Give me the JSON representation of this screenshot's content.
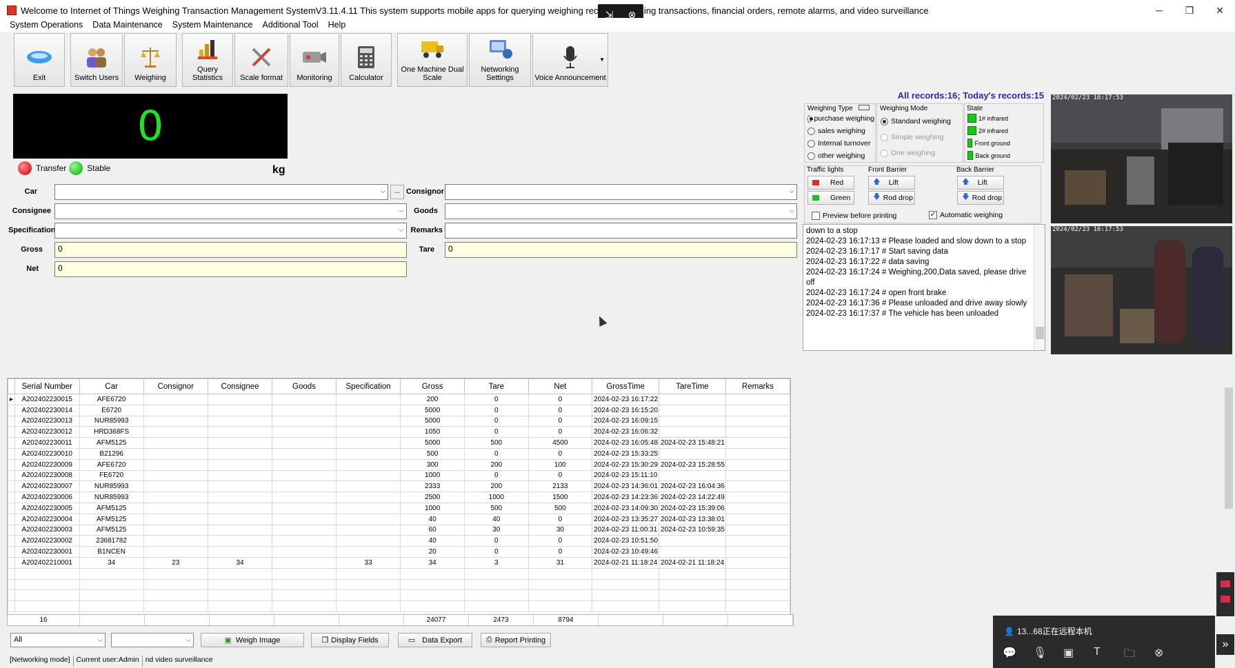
{
  "window": {
    "title": "Welcome to Internet of Things Weighing Transaction Management SystemV3.11.4.11 This system supports mobile apps for querying weighing records, weighing transactions, financial orders, remote alarms, and video surveillance",
    "minimize": "─",
    "maximize": "❐",
    "close": "✕"
  },
  "menu": [
    "System Operations",
    "Data Maintenance",
    "System Maintenance",
    "Additional Tool",
    "Help"
  ],
  "toolbar": [
    {
      "label": "Exit",
      "icon": "exit-icon"
    },
    {
      "label": "Switch Users",
      "icon": "users-icon"
    },
    {
      "label": "Weighing",
      "icon": "balance-scale-icon"
    },
    {
      "label": "Query Statistics",
      "icon": "chart-icon"
    },
    {
      "label": "Scale format",
      "icon": "tools-icon"
    },
    {
      "label": "Monitoring",
      "icon": "camera-icon"
    },
    {
      "label": "Calculator",
      "icon": "calculator-icon"
    },
    {
      "label": "One Machine Dual Scale",
      "icon": "truck-icon"
    },
    {
      "label": "Networking Settings",
      "icon": "network-icon"
    },
    {
      "label": "Voice Announcement",
      "icon": "microphone-icon"
    }
  ],
  "scale": {
    "weight": "0",
    "unit": "kg",
    "transfer_label": "Transfer",
    "stable_label": "Stable"
  },
  "form": {
    "car_label": "Car",
    "car_value": "",
    "consignor_label": "Consignor",
    "consignor_value": "",
    "consignee_label": "Consignee",
    "consignee_value": "",
    "goods_label": "Goods",
    "goods_value": "",
    "specification_label": "Specification",
    "specification_value": "",
    "remarks_label": "Remarks",
    "remarks_value": "",
    "gross_label": "Gross",
    "gross_value": "0",
    "tare_label": "Tare",
    "tare_value": "0",
    "net_label": "Net",
    "net_value": "0",
    "ellipsis": "..."
  },
  "records_summary": "All records:16; Today's records:15",
  "weighing_type": {
    "title": "Weighing Type",
    "options": [
      "purchase weighing",
      "sales weighing",
      "Internal turnover",
      "other weighing"
    ],
    "selected": 0
  },
  "weighing_mode": {
    "title": "Weighing Mode",
    "options": [
      "Standard weighing",
      "Simple weighing",
      "One weighing"
    ],
    "selected": 0
  },
  "state": {
    "title": "State",
    "items": [
      "1# infrared",
      "2# infrared",
      "Front ground",
      "Back ground"
    ],
    "color": "#18c818"
  },
  "traffic_lights": {
    "title": "Traffic lights",
    "red": "Red",
    "green": "Green"
  },
  "front_barrier": {
    "title": "Front Barrier",
    "lift": "Lift",
    "drop": "Rod drop"
  },
  "back_barrier": {
    "title": "Back Barrier",
    "lift": "Lift",
    "drop": "Rod drop"
  },
  "preview_before_printing": {
    "label": "Preview before printing",
    "checked": false
  },
  "automatic_weighing": {
    "label": "Automatic weighing",
    "checked": true
  },
  "log": [
    "down to a stop",
    "2024-02-23 16:17:13 # Please loaded and slow down to a stop",
    "2024-02-23 16:17:17 # Start saving data",
    "2024-02-23 16:17:22 # data saving",
    "2024-02-23 16:17:24 # Weighing,200,Data saved, please drive off",
    "2024-02-23 16:17:24 # open front brake",
    "2024-02-23 16:17:36 # Please unloaded and drive away slowly",
    "2024-02-23 16:17:37 # The vehicle has been unloaded"
  ],
  "cameras": [
    {
      "timestamp": "2024/02/23 16:17:53"
    },
    {
      "timestamp": "2024/02/23 16:17:53"
    }
  ],
  "table": {
    "columns": [
      "Serial Number",
      "Car",
      "Consignor",
      "Consignee",
      "Goods",
      "Specification",
      "Gross",
      "Tare",
      "Net",
      "GrossTime",
      "TareTime",
      "Remarks"
    ],
    "rows": [
      [
        "A202402230015",
        "AFE6720",
        "",
        "",
        "",
        "",
        "200",
        "0",
        "0",
        "2024-02-23 16:17:22",
        "",
        ""
      ],
      [
        "A202402230014",
        "E6720",
        "",
        "",
        "",
        "",
        "5000",
        "0",
        "0",
        "2024-02-23 16:15:20",
        "",
        ""
      ],
      [
        "A202402230013",
        "NUR85993",
        "",
        "",
        "",
        "",
        "5000",
        "0",
        "0",
        "2024-02-23 16:09:15",
        "",
        ""
      ],
      [
        "A202402230012",
        "HRD368FS",
        "",
        "",
        "",
        "",
        "1050",
        "0",
        "0",
        "2024-02-23 16:06:32",
        "",
        ""
      ],
      [
        "A202402230011",
        "AFM5125",
        "",
        "",
        "",
        "",
        "5000",
        "500",
        "4500",
        "2024-02-23 16:05:48",
        "2024-02-23 15:48:21",
        ""
      ],
      [
        "A202402230010",
        "B21296",
        "",
        "",
        "",
        "",
        "500",
        "0",
        "0",
        "2024-02-23 15:33:25",
        "",
        ""
      ],
      [
        "A202402230009",
        "AFE6720",
        "",
        "",
        "",
        "",
        "300",
        "200",
        "100",
        "2024-02-23 15:30:29",
        "2024-02-23 15:28:55",
        ""
      ],
      [
        "A202402230008",
        "FE6720",
        "",
        "",
        "",
        "",
        "1000",
        "0",
        "0",
        "2024-02-23 15:11:10",
        "",
        ""
      ],
      [
        "A202402230007",
        "NUR85993",
        "",
        "",
        "",
        "",
        "2333",
        "200",
        "2133",
        "2024-02-23 14:36:01",
        "2024-02-23 16:04:36",
        ""
      ],
      [
        "A202402230006",
        "NUR85993",
        "",
        "",
        "",
        "",
        "2500",
        "1000",
        "1500",
        "2024-02-23 14:23:36",
        "2024-02-23 14:22:49",
        ""
      ],
      [
        "A202402230005",
        "AFM5125",
        "",
        "",
        "",
        "",
        "1000",
        "500",
        "500",
        "2024-02-23 14:09:30",
        "2024-02-23 15:39:06",
        ""
      ],
      [
        "A202402230004",
        "AFM5125",
        "",
        "",
        "",
        "",
        "40",
        "40",
        "0",
        "2024-02-23 13:35:27",
        "2024-02-23 13:38:01",
        ""
      ],
      [
        "A202402230003",
        "AFM5125",
        "",
        "",
        "",
        "",
        "60",
        "30",
        "30",
        "2024-02-23 11:00:31",
        "2024-02-23 10:59:35",
        ""
      ],
      [
        "A202402230002",
        "23681782",
        "",
        "",
        "",
        "",
        "40",
        "0",
        "0",
        "2024-02-23 10:51:50",
        "",
        ""
      ],
      [
        "A202402230001",
        "B1NCEN",
        "",
        "",
        "",
        "",
        "20",
        "0",
        "0",
        "2024-02-23 10:49:46",
        "",
        ""
      ],
      [
        "A202402210001",
        "34",
        "23",
        "34",
        "",
        "33",
        "34",
        "3",
        "31",
        "2024-02-21 11:18:24",
        "2024-02-21 11:18:24",
        ""
      ]
    ],
    "summary": {
      "count": "16",
      "gross": "24077",
      "tare": "2473",
      "net": "8794"
    }
  },
  "bottom": {
    "filter1": "All",
    "filter2": "",
    "weigh_image": "Weigh Image",
    "display_fields": "Display Fields",
    "data_export": "Data Export",
    "report_printing": "Report Printing"
  },
  "status": [
    "[Networking mode]",
    "Current user:Admin",
    "nd video surveillance"
  ],
  "remote": {
    "title": "13...68正在远程本机"
  }
}
